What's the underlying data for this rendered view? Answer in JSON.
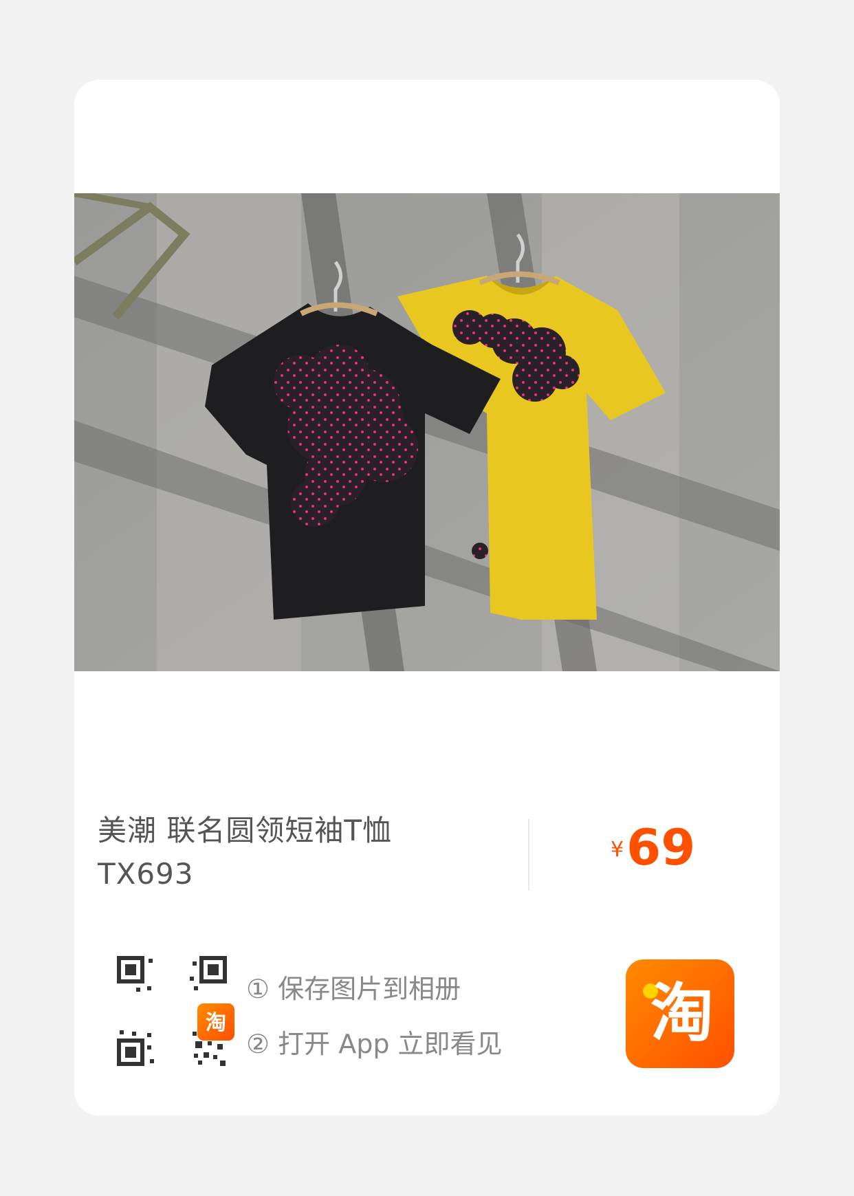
{
  "product": {
    "title": "美潮 联名圆领短袖T恤 TX693",
    "currency_symbol": "¥",
    "price": "69"
  },
  "steps": [
    "① 保存图片到相册",
    "② 打开 App 立即看见"
  ],
  "colors": {
    "accent": "#ff5000",
    "background": "#f2f2f2",
    "card": "#ffffff"
  },
  "icons": {
    "app_logo": "taobao-logo-icon",
    "qr_code": "qr-code-icon"
  }
}
